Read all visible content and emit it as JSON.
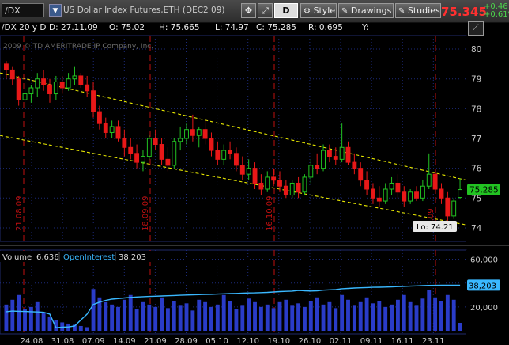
{
  "toolbar": {
    "symbol": "/DX",
    "description": "US Dollar Index Futures,ETH (DEC2 09)",
    "period_letter": "D",
    "style_label": "Style",
    "drawings_label": "Drawings",
    "studies_label": "Studies",
    "last_price": "75.345",
    "change_abs": "+0.46",
    "change_pct": "+0.61%"
  },
  "info_bar": {
    "series": "/DX 20 y D",
    "date": "D: 27.11.09",
    "open": "O: 75.02",
    "high": "H: 75.665",
    "low": "L: 74.97",
    "close": "C: 75.285",
    "range": "R: 0.695",
    "y": "Y:"
  },
  "watermark": "2009 © TD AMERITRADE IP Company, Inc.",
  "price_axis": {
    "ticks": [
      "80",
      "79",
      "78",
      "77",
      "76",
      "75",
      "74"
    ],
    "last_badge": "75.285"
  },
  "low_label": "Lo: 74.21",
  "date_markers": [
    "21.08.09",
    "18.09.09",
    "16.10.09",
    "11.09"
  ],
  "lower_panel": {
    "volume_label": "Volume",
    "volume_value": "6,636",
    "oi_label": "OpenInterest",
    "oi_value": "38,203",
    "ticks": [
      "60,000",
      "40,000",
      "20,000"
    ],
    "oi_badge": "38,203"
  },
  "x_axis_labels": [
    "24.08",
    "31.08",
    "07.09",
    "14.09",
    "21.09",
    "28.09",
    "05.10",
    "12.10",
    "19.10",
    "26.10",
    "02.11",
    "09.11",
    "16.11",
    "23.11"
  ],
  "colors": {
    "up": "#22c322",
    "down": "#e81818",
    "channel": "#e8e800",
    "price_badge": "#22c322",
    "oi_line": "#3ab8ff",
    "volume_bar": "#2a3cc8",
    "marker": "#c01010"
  },
  "chart_data": {
    "type": "candlestick",
    "price_ylim": [
      73.6,
      80.4
    ],
    "candles": [
      {
        "o": 79.5,
        "h": 79.6,
        "l": 79.0,
        "c": 79.3
      },
      {
        "o": 79.3,
        "h": 79.4,
        "l": 78.8,
        "c": 79.0
      },
      {
        "o": 79.0,
        "h": 79.1,
        "l": 78.1,
        "c": 78.3
      },
      {
        "o": 78.3,
        "h": 78.9,
        "l": 78.0,
        "c": 78.5
      },
      {
        "o": 78.5,
        "h": 78.8,
        "l": 78.2,
        "c": 78.7
      },
      {
        "o": 78.7,
        "h": 79.2,
        "l": 78.4,
        "c": 79.0
      },
      {
        "o": 79.0,
        "h": 79.3,
        "l": 78.6,
        "c": 78.8
      },
      {
        "o": 78.8,
        "h": 79.0,
        "l": 78.2,
        "c": 78.5
      },
      {
        "o": 78.5,
        "h": 79.1,
        "l": 78.3,
        "c": 78.9
      },
      {
        "o": 78.9,
        "h": 79.1,
        "l": 78.5,
        "c": 78.7
      },
      {
        "o": 78.7,
        "h": 79.2,
        "l": 78.6,
        "c": 79.0
      },
      {
        "o": 79.0,
        "h": 79.4,
        "l": 78.8,
        "c": 79.1
      },
      {
        "o": 79.1,
        "h": 79.2,
        "l": 78.7,
        "c": 78.8
      },
      {
        "o": 78.8,
        "h": 79.1,
        "l": 78.4,
        "c": 78.6
      },
      {
        "o": 78.6,
        "h": 78.9,
        "l": 77.7,
        "c": 77.9
      },
      {
        "o": 77.9,
        "h": 78.1,
        "l": 77.3,
        "c": 77.5
      },
      {
        "o": 77.5,
        "h": 77.7,
        "l": 77.0,
        "c": 77.2
      },
      {
        "o": 77.2,
        "h": 77.6,
        "l": 77.0,
        "c": 77.4
      },
      {
        "o": 77.4,
        "h": 77.6,
        "l": 76.9,
        "c": 77.0
      },
      {
        "o": 77.0,
        "h": 77.3,
        "l": 76.4,
        "c": 76.7
      },
      {
        "o": 76.7,
        "h": 77.0,
        "l": 76.3,
        "c": 76.5
      },
      {
        "o": 76.5,
        "h": 76.8,
        "l": 76.0,
        "c": 76.2
      },
      {
        "o": 76.2,
        "h": 76.6,
        "l": 75.9,
        "c": 76.4
      },
      {
        "o": 76.4,
        "h": 77.1,
        "l": 76.3,
        "c": 77.0
      },
      {
        "o": 77.0,
        "h": 77.3,
        "l": 76.6,
        "c": 76.8
      },
      {
        "o": 76.8,
        "h": 77.0,
        "l": 76.1,
        "c": 76.3
      },
      {
        "o": 76.3,
        "h": 76.7,
        "l": 75.9,
        "c": 76.1
      },
      {
        "o": 76.1,
        "h": 77.0,
        "l": 76.0,
        "c": 76.9
      },
      {
        "o": 76.9,
        "h": 77.4,
        "l": 76.6,
        "c": 77.0
      },
      {
        "o": 77.0,
        "h": 77.5,
        "l": 76.8,
        "c": 77.3
      },
      {
        "o": 77.3,
        "h": 77.8,
        "l": 76.9,
        "c": 77.1
      },
      {
        "o": 77.1,
        "h": 77.4,
        "l": 76.7,
        "c": 77.3
      },
      {
        "o": 77.3,
        "h": 77.6,
        "l": 76.8,
        "c": 77.0
      },
      {
        "o": 77.0,
        "h": 77.2,
        "l": 76.4,
        "c": 76.6
      },
      {
        "o": 76.6,
        "h": 76.9,
        "l": 76.1,
        "c": 76.3
      },
      {
        "o": 76.3,
        "h": 76.8,
        "l": 76.1,
        "c": 76.6
      },
      {
        "o": 76.6,
        "h": 76.9,
        "l": 76.3,
        "c": 76.5
      },
      {
        "o": 76.5,
        "h": 76.7,
        "l": 75.9,
        "c": 76.1
      },
      {
        "o": 76.1,
        "h": 76.4,
        "l": 75.6,
        "c": 75.8
      },
      {
        "o": 75.8,
        "h": 76.3,
        "l": 75.6,
        "c": 76.0
      },
      {
        "o": 76.0,
        "h": 76.2,
        "l": 75.3,
        "c": 75.5
      },
      {
        "o": 75.5,
        "h": 75.8,
        "l": 75.1,
        "c": 75.3
      },
      {
        "o": 75.3,
        "h": 75.9,
        "l": 75.2,
        "c": 75.7
      },
      {
        "o": 75.7,
        "h": 76.0,
        "l": 75.4,
        "c": 75.6
      },
      {
        "o": 75.6,
        "h": 75.9,
        "l": 75.2,
        "c": 75.4
      },
      {
        "o": 75.4,
        "h": 75.6,
        "l": 75.0,
        "c": 75.1
      },
      {
        "o": 75.1,
        "h": 75.6,
        "l": 75.0,
        "c": 75.5
      },
      {
        "o": 75.5,
        "h": 75.7,
        "l": 75.0,
        "c": 75.2
      },
      {
        "o": 75.2,
        "h": 75.8,
        "l": 75.1,
        "c": 75.7
      },
      {
        "o": 75.7,
        "h": 76.3,
        "l": 75.5,
        "c": 76.1
      },
      {
        "o": 76.1,
        "h": 76.5,
        "l": 75.8,
        "c": 76.0
      },
      {
        "o": 76.0,
        "h": 76.8,
        "l": 75.9,
        "c": 76.6
      },
      {
        "o": 76.6,
        "h": 76.8,
        "l": 76.2,
        "c": 76.4
      },
      {
        "o": 76.4,
        "h": 76.7,
        "l": 76.1,
        "c": 76.3
      },
      {
        "o": 76.3,
        "h": 77.5,
        "l": 76.2,
        "c": 76.7
      },
      {
        "o": 76.7,
        "h": 76.9,
        "l": 76.1,
        "c": 76.2
      },
      {
        "o": 76.2,
        "h": 76.5,
        "l": 75.8,
        "c": 76.0
      },
      {
        "o": 76.0,
        "h": 76.2,
        "l": 75.4,
        "c": 75.6
      },
      {
        "o": 75.6,
        "h": 75.9,
        "l": 75.1,
        "c": 75.3
      },
      {
        "o": 75.3,
        "h": 75.5,
        "l": 74.8,
        "c": 75.0
      },
      {
        "o": 75.0,
        "h": 75.4,
        "l": 74.7,
        "c": 74.9
      },
      {
        "o": 74.9,
        "h": 75.5,
        "l": 74.8,
        "c": 75.3
      },
      {
        "o": 75.3,
        "h": 75.7,
        "l": 75.1,
        "c": 75.5
      },
      {
        "o": 75.5,
        "h": 75.8,
        "l": 75.0,
        "c": 75.2
      },
      {
        "o": 75.2,
        "h": 75.4,
        "l": 74.7,
        "c": 74.9
      },
      {
        "o": 74.9,
        "h": 75.3,
        "l": 74.8,
        "c": 75.2
      },
      {
        "o": 75.2,
        "h": 75.4,
        "l": 74.9,
        "c": 75.0
      },
      {
        "o": 75.0,
        "h": 75.6,
        "l": 74.9,
        "c": 75.4
      },
      {
        "o": 75.4,
        "h": 76.5,
        "l": 75.3,
        "c": 75.8
      },
      {
        "o": 75.8,
        "h": 75.9,
        "l": 75.2,
        "c": 75.3
      },
      {
        "o": 75.3,
        "h": 75.5,
        "l": 74.8,
        "c": 75.0
      },
      {
        "o": 75.0,
        "h": 75.2,
        "l": 74.21,
        "c": 74.4
      },
      {
        "o": 74.4,
        "h": 75.0,
        "l": 74.3,
        "c": 74.9
      },
      {
        "o": 75.02,
        "h": 75.665,
        "l": 74.97,
        "c": 75.285
      }
    ],
    "channel_upper": [
      79.2,
      75.6
    ],
    "channel_lower": [
      77.1,
      74.1
    ],
    "volume_ylim": [
      0,
      65000
    ],
    "volume": [
      22000,
      26000,
      30000,
      18000,
      20000,
      24000,
      15000,
      12000,
      9000,
      7000,
      6000,
      5000,
      4000,
      3000,
      35000,
      28000,
      24000,
      22000,
      20000,
      26000,
      30000,
      18000,
      24000,
      22000,
      20000,
      28000,
      19000,
      25000,
      21000,
      23000,
      17000,
      26000,
      24000,
      20000,
      22000,
      30000,
      25000,
      18000,
      21000,
      27000,
      24000,
      20000,
      22000,
      19000,
      24000,
      26000,
      21000,
      23000,
      20000,
      25000,
      28000,
      22000,
      24000,
      19000,
      30000,
      26000,
      21000,
      24000,
      28000,
      23000,
      25000,
      20000,
      22000,
      26000,
      30000,
      24000,
      21000,
      27000,
      34000,
      28000,
      25000,
      30000,
      26000,
      6636
    ],
    "open_interest": [
      16000,
      16500,
      16300,
      16200,
      16000,
      15800,
      15500,
      14000,
      2500,
      3000,
      3200,
      4000,
      9000,
      14000,
      22000,
      24000,
      25500,
      26500,
      27000,
      27500,
      28000,
      28300,
      28600,
      28800,
      29000,
      29200,
      29400,
      29600,
      29800,
      30000,
      30200,
      30300,
      30500,
      30600,
      30800,
      31000,
      31200,
      31300,
      31500,
      31700,
      31800,
      32000,
      32200,
      32500,
      32800,
      33000,
      33200,
      33800,
      33500,
      33300,
      33400,
      34000,
      34300,
      34500,
      35200,
      35500,
      35800,
      36000,
      36200,
      36400,
      36500,
      36600,
      36800,
      37000,
      37200,
      37400,
      37600,
      37800,
      38000,
      38100,
      38200,
      38150,
      38200,
      38203
    ]
  }
}
